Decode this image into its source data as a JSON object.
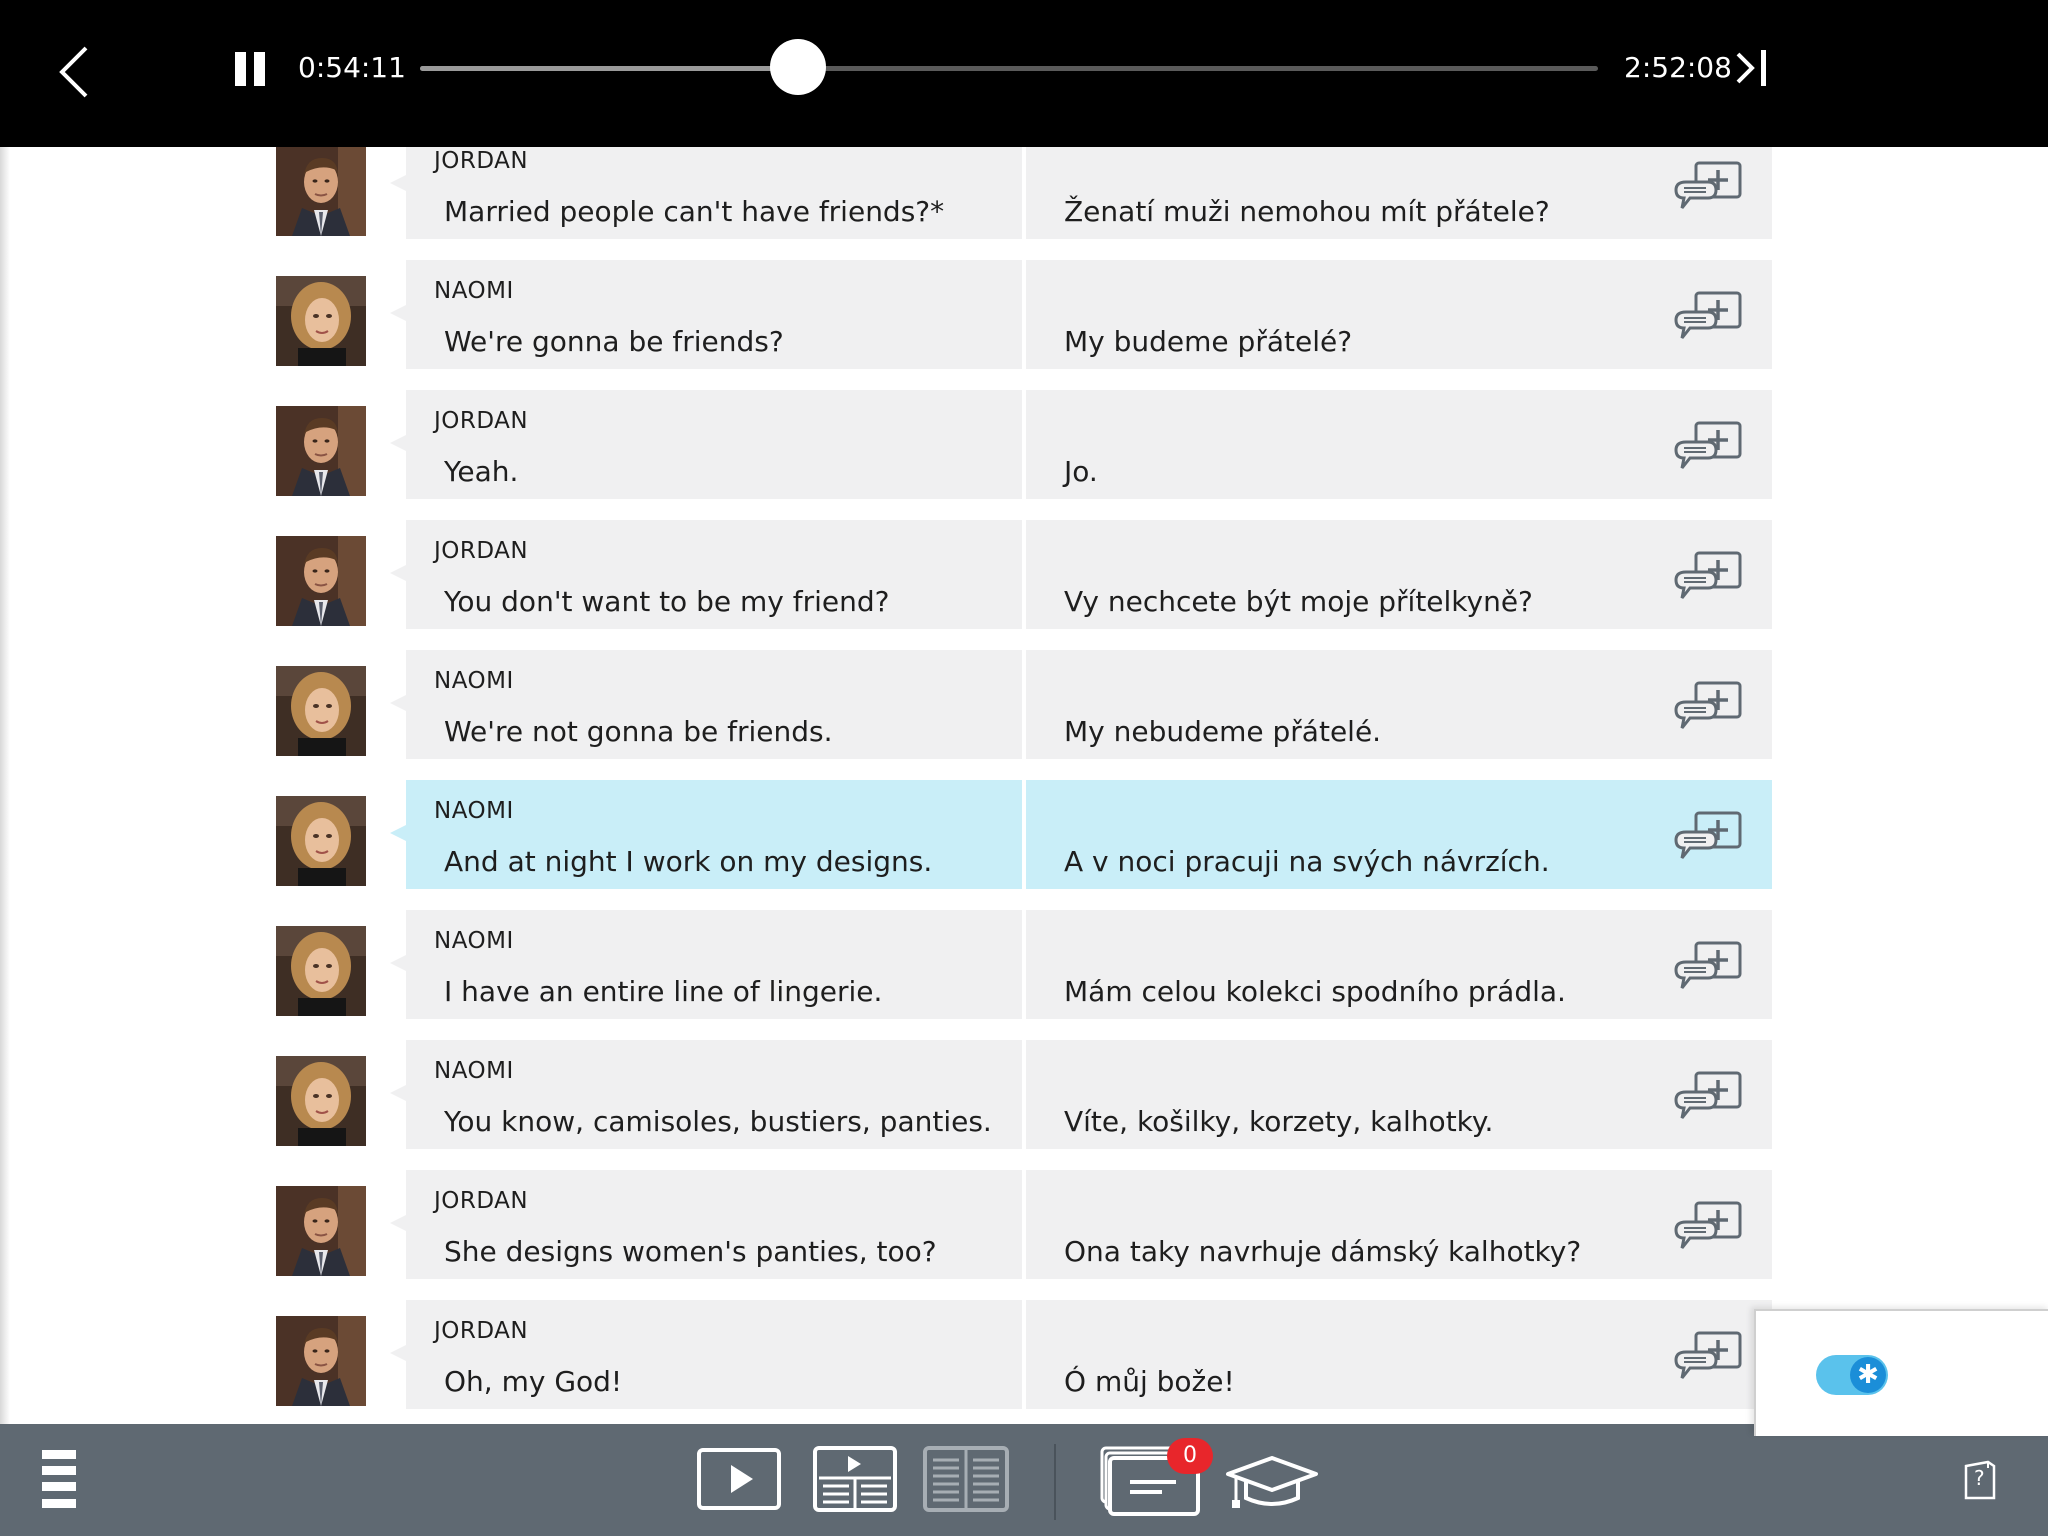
{
  "player": {
    "current_time": "0:54:11",
    "duration": "2:52:08",
    "progress": 0.3205,
    "state": "playing"
  },
  "rows": [
    {
      "speaker": "JORDAN",
      "en": "Married people can't have friends?*",
      "cs": "Ženatí muži nemohou mít přátele?",
      "avatar": "jordan",
      "active": false
    },
    {
      "speaker": "NAOMI",
      "en": "We're gonna be friends?",
      "cs": "My budeme přátelé?",
      "avatar": "naomi",
      "active": false
    },
    {
      "speaker": "JORDAN",
      "en": "Yeah.",
      "cs": "Jo.",
      "avatar": "jordan",
      "active": false
    },
    {
      "speaker": "JORDAN",
      "en": "You don't want to be my friend?",
      "cs": "Vy nechcete být moje přítelkyně?",
      "avatar": "jordan",
      "active": false
    },
    {
      "speaker": "NAOMI",
      "en": "We're not gonna be friends.",
      "cs": "My nebudeme přátelé.",
      "avatar": "naomi",
      "active": false
    },
    {
      "speaker": "NAOMI",
      "en": "And at night I work on my designs.",
      "cs": "A v noci pracuji na svých návrzích.",
      "avatar": "naomi",
      "active": true
    },
    {
      "speaker": "NAOMI",
      "en": "I have an entire line of lingerie.",
      "cs": "Mám celou kolekci spodního prádla.",
      "avatar": "naomi",
      "active": false
    },
    {
      "speaker": "NAOMI",
      "en": "You know, camisoles, bustiers, panties.",
      "cs": "Víte, košilky, korzety, kalhotky.",
      "avatar": "naomi",
      "active": false
    },
    {
      "speaker": "JORDAN",
      "en": "She designs women's panties, too?",
      "cs": "Ona taky navrhuje dámský kalhotky?",
      "avatar": "jordan",
      "active": false
    },
    {
      "speaker": "JORDAN",
      "en": "Oh, my God!",
      "cs": "Ó můj bože!",
      "avatar": "jordan",
      "active": false
    },
    {
      "speaker": "JORDAN",
      "en": "",
      "cs": "",
      "avatar": "jordan",
      "active": false
    }
  ],
  "toolbar": {
    "flashcards_badge": "0",
    "help_label": "?"
  },
  "toggle": {
    "on": true,
    "icon": "✱"
  },
  "colors": {
    "active_row": "#c9eef8",
    "row_bg": "#f0f0f1",
    "toolbar_bg": "#5f6972",
    "badge": "#e8262b",
    "toggle": "#5ac2ec"
  },
  "icons": {
    "back": "chevron-left-icon",
    "pause": "pause-icon",
    "next": "skip-forward-icon",
    "add_note": "add-comment-icon",
    "menu": "menu-icon",
    "video": "video-mode-icon",
    "split": "video-subtitles-mode-icon",
    "text": "text-mode-icon",
    "cards": "flashcards-icon",
    "learn": "graduation-cap-icon",
    "help": "help-icon"
  }
}
